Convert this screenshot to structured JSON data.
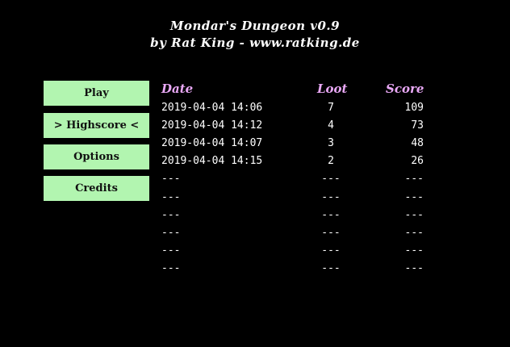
{
  "title": {
    "line1": "Mondar's Dungeon v0.9",
    "line2": "by Rat King - www.ratking.de"
  },
  "menu": {
    "play": "Play",
    "highscore": "> Highscore <",
    "options": "Options",
    "credits": "Credits"
  },
  "colors": {
    "background": "#000000",
    "button_bg": "#b2f5b0",
    "header_text": "#e9a8f6",
    "text": "#ffffff"
  },
  "highscore": {
    "headers": {
      "date": "Date",
      "loot": "Loot",
      "score": "Score"
    },
    "rows": [
      {
        "date": "2019-04-04 14:06",
        "loot": "7",
        "score": "109"
      },
      {
        "date": "2019-04-04 14:12",
        "loot": "4",
        "score": "73"
      },
      {
        "date": "2019-04-04 14:07",
        "loot": "3",
        "score": "48"
      },
      {
        "date": "2019-04-04 14:15",
        "loot": "2",
        "score": "26"
      },
      {
        "date": "---",
        "loot": "---",
        "score": "---"
      },
      {
        "date": "---",
        "loot": "---",
        "score": "---"
      },
      {
        "date": "---",
        "loot": "---",
        "score": "---"
      },
      {
        "date": "---",
        "loot": "---",
        "score": "---"
      },
      {
        "date": "---",
        "loot": "---",
        "score": "---"
      },
      {
        "date": "---",
        "loot": "---",
        "score": "---"
      }
    ]
  }
}
